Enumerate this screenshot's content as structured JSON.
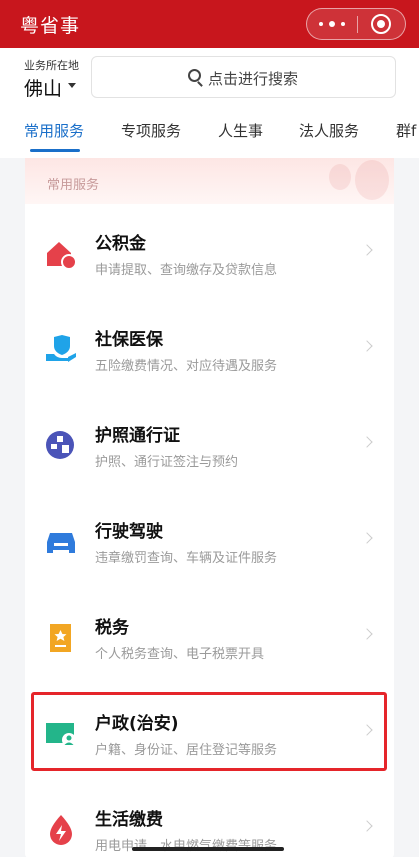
{
  "header": {
    "title": "粤省事"
  },
  "location": {
    "label": "业务所在地",
    "city": "佛山"
  },
  "search": {
    "placeholder": "点击进行搜索"
  },
  "tabs": [
    {
      "label": "常用服务",
      "active": true
    },
    {
      "label": "专项服务",
      "active": false
    },
    {
      "label": "人生事",
      "active": false
    },
    {
      "label": "法人服务",
      "active": false
    },
    {
      "label": "群f",
      "active": false
    }
  ],
  "panel": {
    "title": "常用服务",
    "items": [
      {
        "name": "公积金",
        "desc": "申请提取、查询缴存及贷款信息",
        "icon": "house-icon",
        "color": "#e5414a"
      },
      {
        "name": "社保医保",
        "desc": "五险缴费情况、对应待遇及服务",
        "icon": "hand-shield-icon",
        "color": "#1fa3e8"
      },
      {
        "name": "护照通行证",
        "desc": "护照、通行证签注与预约",
        "icon": "passport-icon",
        "color": "#4b54b8"
      },
      {
        "name": "行驶驾驶",
        "desc": "违章缴罚查询、车辆及证件服务",
        "icon": "car-icon",
        "color": "#2f7bdc"
      },
      {
        "name": "税务",
        "desc": "个人税务查询、电子税票开具",
        "icon": "tax-doc-icon",
        "color": "#f2a623"
      },
      {
        "name": "户政(治安)",
        "desc": "户籍、身份证、居住登记等服务",
        "icon": "id-card-icon",
        "color": "#23b58a"
      },
      {
        "name": "生活缴费",
        "desc": "用电申请、水电燃气缴费等服务",
        "icon": "bolt-icon",
        "color": "#e5414a"
      }
    ]
  },
  "highlight_color": "#e5252a"
}
